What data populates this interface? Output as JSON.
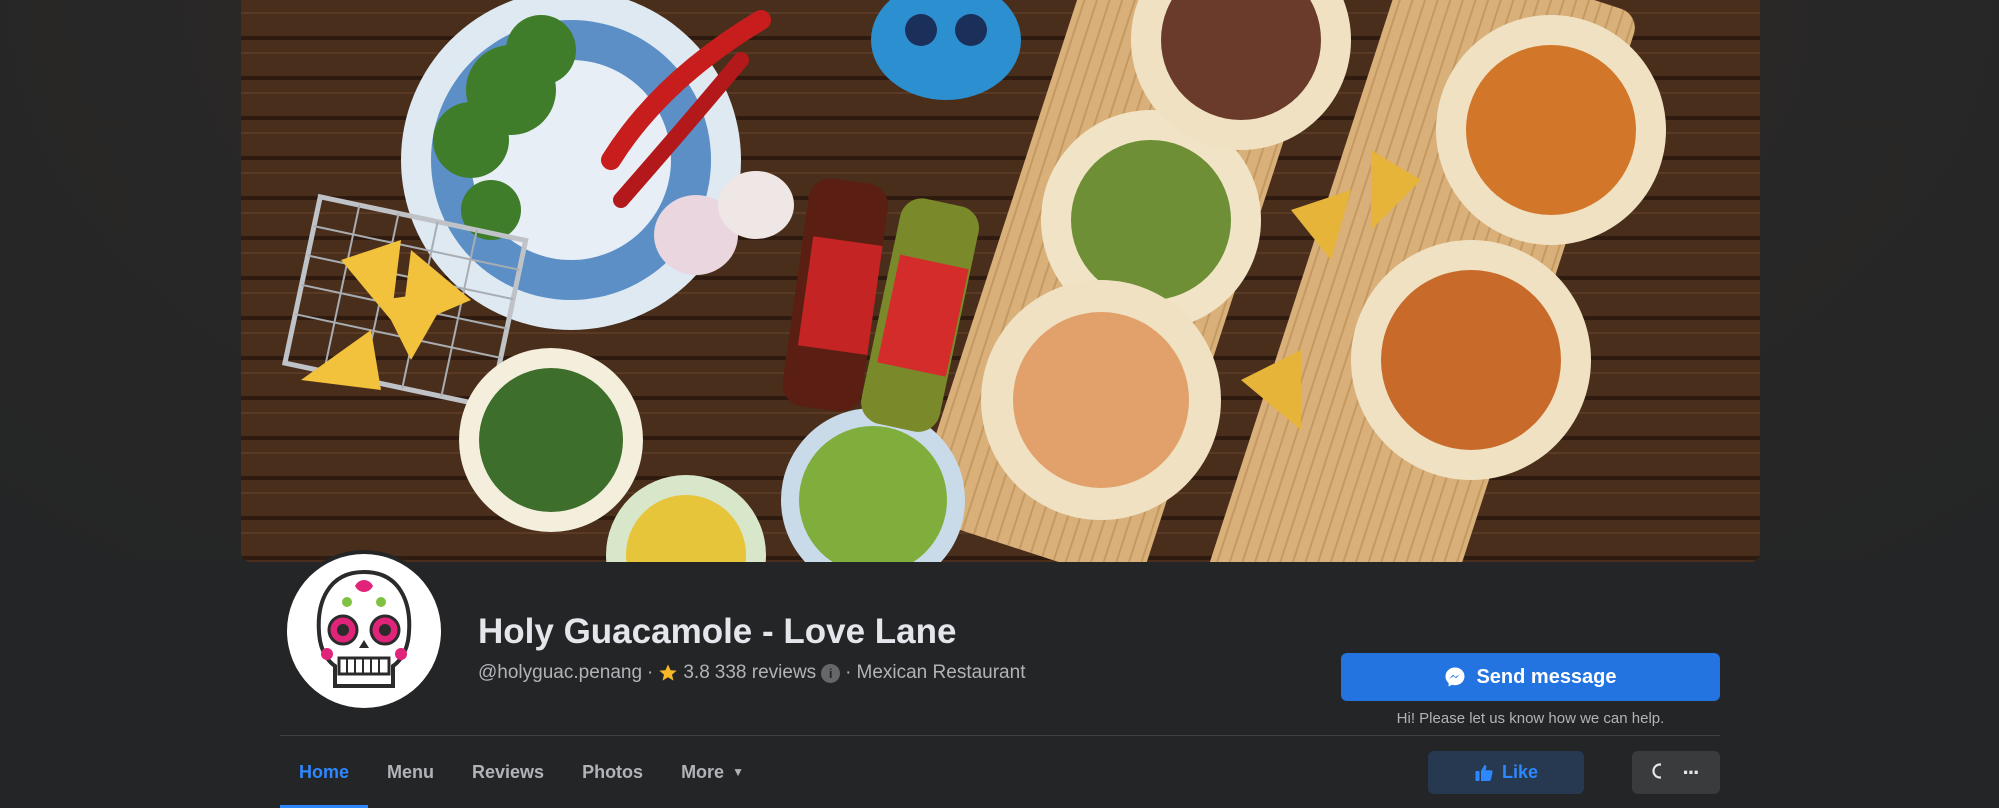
{
  "page": {
    "name": "Holy Guacamole - Love Lane",
    "handle": "@holyguac.penang",
    "separator": "·",
    "rating": "3.8",
    "reviews": "338 reviews",
    "category": "Mexican Restaurant",
    "info_glyph": "i"
  },
  "actions": {
    "send_message_label": "Send message",
    "send_message_hint": "Hi! Please let us know how we can help.",
    "like_label": "Like",
    "more_glyph": "···"
  },
  "tabs": [
    {
      "label": "Home",
      "active": true
    },
    {
      "label": "Menu",
      "active": false
    },
    {
      "label": "Reviews",
      "active": false
    },
    {
      "label": "Photos",
      "active": false
    },
    {
      "label": "More",
      "active": false,
      "has_dropdown": true,
      "caret": "▼"
    }
  ],
  "colors": {
    "accent": "#2d88ff",
    "button_primary": "#2374e1",
    "background": "#242526",
    "star": "#f7b928"
  },
  "icons": {
    "cover": "food-spread-photo",
    "avatar": "sugar-skull-logo",
    "rating": "star-icon",
    "info": "info-icon",
    "send": "messenger-icon",
    "like": "thumbs-up-icon",
    "search": "search-icon",
    "more": "ellipsis-icon"
  }
}
